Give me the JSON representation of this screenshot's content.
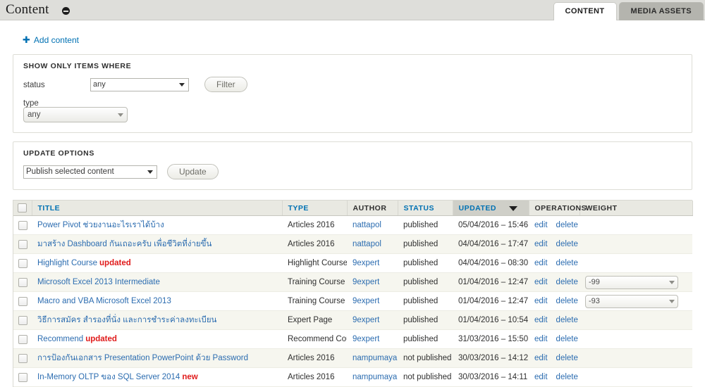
{
  "header": {
    "title": "Content",
    "collapse_icon": "minus-circle-icon",
    "tabs": [
      {
        "label": "CONTENT",
        "active": true
      },
      {
        "label": "MEDIA ASSETS",
        "active": false
      }
    ]
  },
  "actions": {
    "add_content_label": "Add content",
    "add_icon": "plus-icon"
  },
  "filter_panel": {
    "legend": "SHOW ONLY ITEMS WHERE",
    "status_label": "status",
    "status_value": "any",
    "type_label": "type",
    "type_value": "any",
    "filter_button": "Filter"
  },
  "update_panel": {
    "legend": "UPDATE OPTIONS",
    "action_value": "Publish selected content",
    "update_button": "Update"
  },
  "table": {
    "columns": [
      {
        "label": "TITLE",
        "link": true,
        "sorted": false
      },
      {
        "label": "TYPE",
        "link": true,
        "sorted": false
      },
      {
        "label": "AUTHOR",
        "link": false,
        "sorted": false
      },
      {
        "label": "STATUS",
        "link": true,
        "sorted": false
      },
      {
        "label": "UPDATED",
        "link": true,
        "sorted": true
      },
      {
        "label": "OPERATIONS",
        "link": false,
        "sorted": false
      },
      {
        "label": "WEIGHT",
        "link": false,
        "sorted": false
      }
    ],
    "operations": {
      "edit": "edit",
      "delete": "delete"
    },
    "rows": [
      {
        "title": "Power Pivot ช่วยงานอะไรเราได้บ้าง",
        "badge": "",
        "type": "Articles 2016",
        "author": "nattapol",
        "status": "published",
        "updated": "05/04/2016 – 15:46",
        "weight": ""
      },
      {
        "title": "มาสร้าง Dashboard กันเถอะครับ เพื่อชีวิตที่ง่ายขึ้น",
        "badge": "",
        "type": "Articles 2016",
        "author": "nattapol",
        "status": "published",
        "updated": "04/04/2016 – 17:47",
        "weight": ""
      },
      {
        "title": "Highlight Course",
        "badge": "updated",
        "type": "Highlight Course",
        "author": "9expert",
        "status": "published",
        "updated": "04/04/2016 – 08:30",
        "weight": ""
      },
      {
        "title": "Microsoft Excel 2013 Intermediate",
        "badge": "",
        "type": "Training Course",
        "author": "9expert",
        "status": "published",
        "updated": "01/04/2016 – 12:47",
        "weight": "-99"
      },
      {
        "title": "Macro and VBA Microsoft Excel 2013",
        "badge": "",
        "type": "Training Course",
        "author": "9expert",
        "status": "published",
        "updated": "01/04/2016 – 12:47",
        "weight": "-93"
      },
      {
        "title": "วิธีการสมัคร สำรองที่นั่ง และการชำระค่าลงทะเบียน",
        "badge": "",
        "type": "Expert Page",
        "author": "9expert",
        "status": "published",
        "updated": "01/04/2016 – 10:54",
        "weight": ""
      },
      {
        "title": "Recommend",
        "badge": "updated",
        "type": "Recommend Course",
        "author": "9expert",
        "status": "published",
        "updated": "31/03/2016 – 15:50",
        "weight": ""
      },
      {
        "title": "การป้องกันเอกสาร Presentation PowerPoint ด้วย Password",
        "badge": "",
        "type": "Articles 2016",
        "author": "nampumaya",
        "status": "not published",
        "updated": "30/03/2016 – 14:12",
        "weight": ""
      },
      {
        "title": "In-Memory OLTP ของ SQL Server 2014",
        "badge": "new",
        "type": "Articles 2016",
        "author": "nampumaya",
        "status": "not published",
        "updated": "30/03/2016 – 14:11",
        "weight": ""
      }
    ]
  },
  "colors": {
    "link": "#2b6cb0",
    "header_link": "#0071b3",
    "badge": "#e01b1b",
    "topbar_bg": "#dededa",
    "row_alt_bg": "#f6f6ef"
  }
}
